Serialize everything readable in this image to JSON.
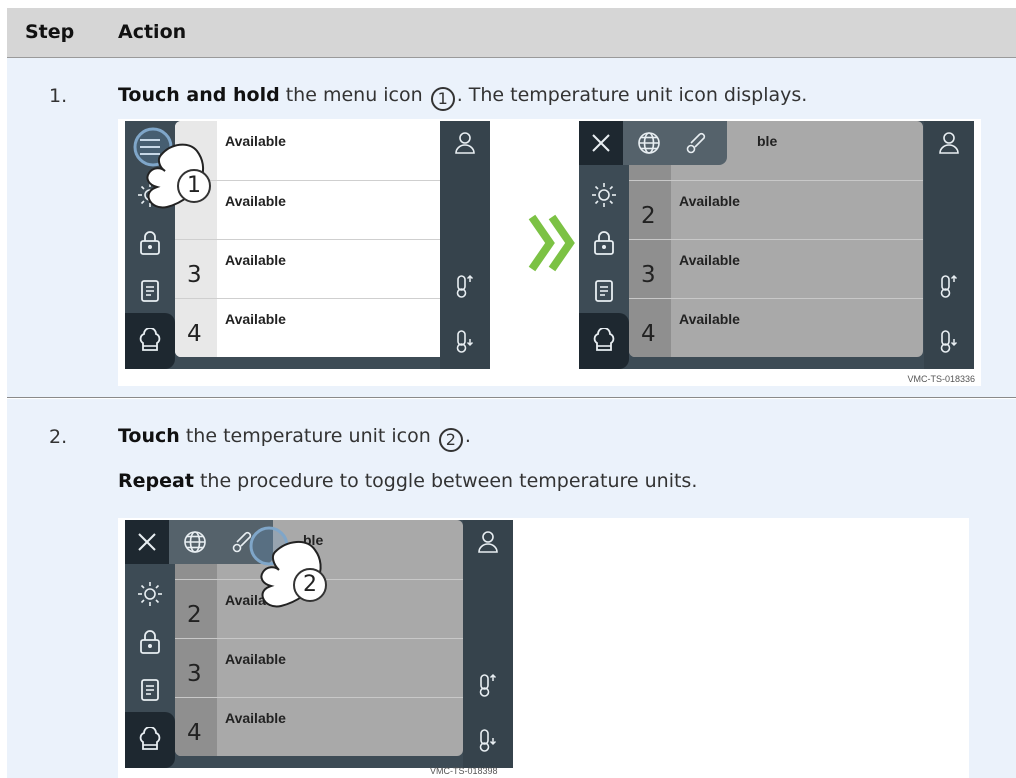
{
  "table": {
    "headers": {
      "step": "Step",
      "action": "Action"
    },
    "rows": [
      {
        "step": "1.",
        "parts": {
          "bold": "Touch and hold",
          "mid": " the menu icon ",
          "circle": "1",
          "end": ". The temperature unit icon displays."
        },
        "figure": {
          "caption": "VMC-TS-018336",
          "before_screen": {
            "slots": [
              {
                "num": "",
                "label": "Available"
              },
              {
                "num": "",
                "label": "Available"
              },
              {
                "num": "3",
                "label": "Available"
              },
              {
                "num": "4",
                "label": "Available"
              }
            ],
            "callout": "1"
          },
          "after_screen": {
            "slots": [
              {
                "num": "",
                "label": "ble"
              },
              {
                "num": "2",
                "label": "Available"
              },
              {
                "num": "3",
                "label": "Available"
              },
              {
                "num": "4",
                "label": "Available"
              }
            ]
          }
        }
      },
      {
        "step": "2.",
        "parts": {
          "bold": "Touch",
          "mid": " the temperature unit icon ",
          "circle": "2",
          "end": "."
        },
        "parts2": {
          "bold": "Repeat",
          "end": " the procedure to toggle between temperature units."
        },
        "figure": {
          "caption": "VMC-TS-018398",
          "screen": {
            "slots": [
              {
                "num": "",
                "label": "ble"
              },
              {
                "num": "2",
                "label": "Availa"
              },
              {
                "num": "3",
                "label": "Available"
              },
              {
                "num": "4",
                "label": "Available"
              }
            ],
            "callout": "2"
          }
        }
      }
    ]
  },
  "icons": {
    "sidebar": [
      "menu-icon",
      "brightness-icon",
      "lock-icon",
      "recipe-book-icon",
      "chef-hat-icon"
    ],
    "right": [
      "user-icon",
      "temperature-up-icon",
      "temperature-down-icon"
    ],
    "menubar": [
      "close-icon",
      "globe-icon",
      "thermometer-icon"
    ],
    "arrow": "double-chevron-right-icon"
  },
  "colors": {
    "header_bg": "#d6d6d6",
    "row_bg": "#ebf2fb",
    "screen_bg": "#3d4b55",
    "arrow": "#7cc244"
  }
}
